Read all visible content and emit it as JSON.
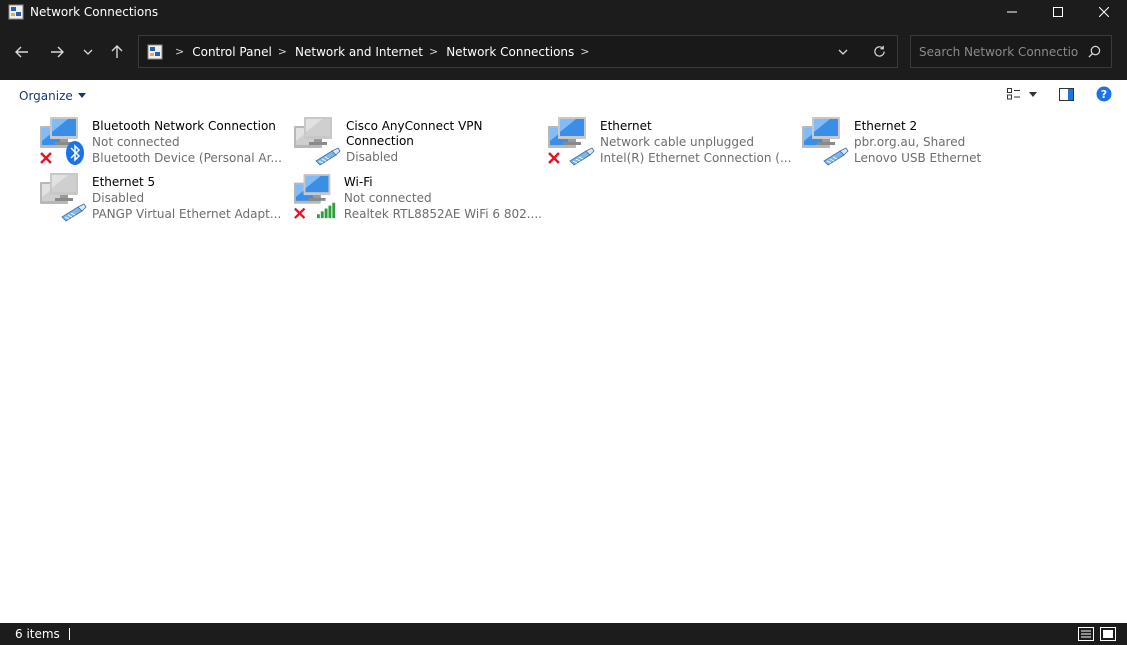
{
  "window": {
    "title": "Network Connections"
  },
  "address": {
    "crumbs": [
      "Control Panel",
      "Network and Internet",
      "Network Connections"
    ]
  },
  "search": {
    "placeholder": "Search Network Connections"
  },
  "toolbar": {
    "organize_label": "Organize"
  },
  "items": [
    {
      "name": "Bluetooth Network Connection",
      "name2": "",
      "status": "Not connected",
      "device": "Bluetooth Device (Personal Ar...",
      "badge": "bluetooth-icon",
      "disabled": false,
      "error": true
    },
    {
      "name": "Cisco AnyConnect VPN",
      "name2": "Connection",
      "status": "Disabled",
      "device": "",
      "badge": "network-cable-icon",
      "disabled": true,
      "error": false
    },
    {
      "name": "Ethernet",
      "name2": "",
      "status": "Network cable unplugged",
      "device": "Intel(R) Ethernet Connection (...",
      "badge": "network-cable-icon",
      "disabled": false,
      "error": true
    },
    {
      "name": "Ethernet 2",
      "name2": "",
      "status": "pbr.org.au, Shared",
      "device": "Lenovo USB Ethernet",
      "badge": "network-cable-icon",
      "disabled": false,
      "error": false
    },
    {
      "name": "Ethernet 5",
      "name2": "",
      "status": "Disabled",
      "device": "PANGP Virtual Ethernet Adapt...",
      "badge": "network-cable-icon",
      "disabled": true,
      "error": false
    },
    {
      "name": "Wi-Fi",
      "name2": "",
      "status": "Not connected",
      "device": "Realtek RTL8852AE WiFi 6 802....",
      "badge": "wifi-signal-icon",
      "disabled": false,
      "error": true
    }
  ],
  "status_bar": {
    "item_count": "6 items"
  },
  "colors": {
    "chrome_bg": "#1c1c1c",
    "link_blue": "#1b3a6b",
    "help_blue": "#1a73e8",
    "error_red": "#e81123"
  }
}
